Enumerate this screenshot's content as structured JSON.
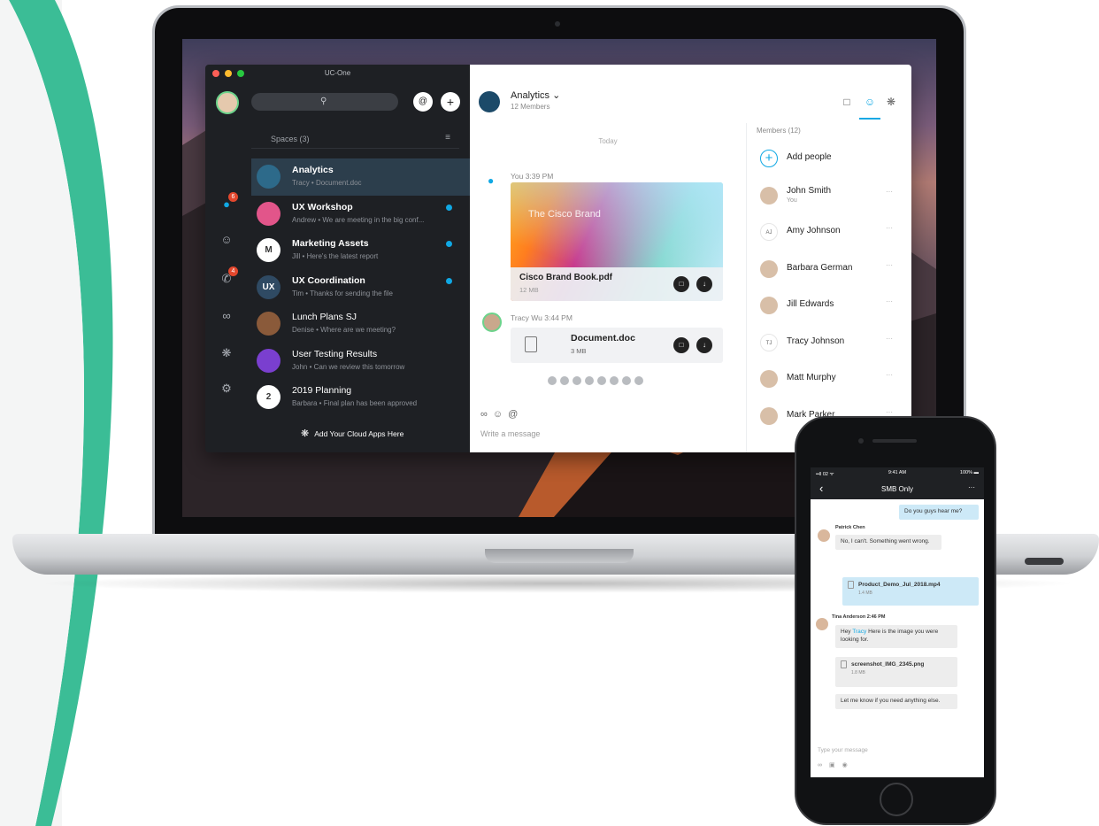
{
  "colors": {
    "accent_teal": "#3bbd96",
    "accent_blue": "#10a8e4",
    "dark_pane": "#1e2024",
    "badge_red": "#e3472d"
  },
  "desktop": {
    "window_title": "UC-One",
    "search": {
      "icon": "search-icon"
    },
    "rail": {
      "messages_badge": "6",
      "calls_badge": "4"
    },
    "spaces_header": "Spaces (3)",
    "spaces": [
      {
        "avatar": "",
        "title": "Analytics",
        "subtitle": "Tracy • Document.doc",
        "selected": true,
        "unread": false,
        "avatar_color": "#2d6a8a"
      },
      {
        "avatar": "",
        "title": "UX Workshop",
        "subtitle": "Andrew • We are meeting in the big conf...",
        "selected": false,
        "unread": true,
        "avatar_color": "#e2558a"
      },
      {
        "avatar": "M",
        "title": "Marketing Assets",
        "subtitle": "Jill • Here's the latest report",
        "selected": false,
        "unread": true,
        "avatar_color": "#ffffff"
      },
      {
        "avatar": "UX",
        "title": "UX Coordination",
        "subtitle": "Tim • Thanks for sending the file",
        "selected": false,
        "unread": true,
        "avatar_color": "#2f4a63"
      },
      {
        "avatar": "",
        "title": "Lunch Plans SJ",
        "subtitle": "Denise • Where are we meeting?",
        "selected": false,
        "unread": false,
        "avatar_color": "#8a5a3a"
      },
      {
        "avatar": "",
        "title": "User Testing Results",
        "subtitle": "John • Can we review this tomorrow",
        "selected": false,
        "unread": false,
        "avatar_color": "#7a3fcf"
      },
      {
        "avatar": "2",
        "title": "2019 Planning",
        "subtitle": "Barbara • Final plan has been approved",
        "selected": false,
        "unread": false,
        "avatar_color": "#ffffff"
      }
    ],
    "cloud_apps": "Add Your Cloud Apps Here",
    "chat": {
      "title": "Analytics ⌄",
      "subtitle": "12 Members",
      "day_divider": "Today",
      "msg1_meta": "You  3:39 PM",
      "file1": {
        "preview_text": "The Cisco Brand",
        "name": "Cisco Brand Book.pdf",
        "size": "12 MB"
      },
      "msg2_meta": "Tracy Wu  3:44 PM",
      "file2": {
        "name": "Document.doc",
        "size": "3 MB"
      },
      "composer_placeholder": "Write a message"
    },
    "members": {
      "title": "Members (12)",
      "list": [
        {
          "name": "Add people",
          "sub": "",
          "kind": "add",
          "initials": "+"
        },
        {
          "name": "John Smith",
          "sub": "You",
          "kind": "photo",
          "initials": ""
        },
        {
          "name": "Amy Johnson",
          "sub": "",
          "kind": "initials",
          "initials": "AJ"
        },
        {
          "name": "Barbara German",
          "sub": "",
          "kind": "photo",
          "initials": ""
        },
        {
          "name": "Jill Edwards",
          "sub": "",
          "kind": "photo",
          "initials": ""
        },
        {
          "name": "Tracy Johnson",
          "sub": "",
          "kind": "initials",
          "initials": "TJ"
        },
        {
          "name": "Matt Murphy",
          "sub": "",
          "kind": "photo",
          "initials": ""
        },
        {
          "name": "Mark Parker",
          "sub": "",
          "kind": "photo",
          "initials": ""
        }
      ],
      "more": "···"
    }
  },
  "phone": {
    "status": {
      "carrier": "••ll 02 ᯤ",
      "time": "9:41 AM",
      "battery": "100% ▬"
    },
    "nav_title": "SMB Only",
    "messages": {
      "own1": "Do you guys hear me?",
      "patrick_name": "Patrick Chen",
      "patrick_text": "No, I can't. Something went wrong.",
      "file1_name": "Product_Demo_Jul_2018.mp4",
      "file1_size": "1.4 MB",
      "tina_name": "Tina Anderson 2:46 PM",
      "tina_pre": "Hey ",
      "tina_mention": "Tracy",
      "tina_post": " Here is the image you were looking for.",
      "file2_name": "screenshot_IMG_2345.png",
      "file2_size": "1.8 MB",
      "tina_followup": "Let me know if you need anything else."
    },
    "input_placeholder": "Type your message"
  }
}
